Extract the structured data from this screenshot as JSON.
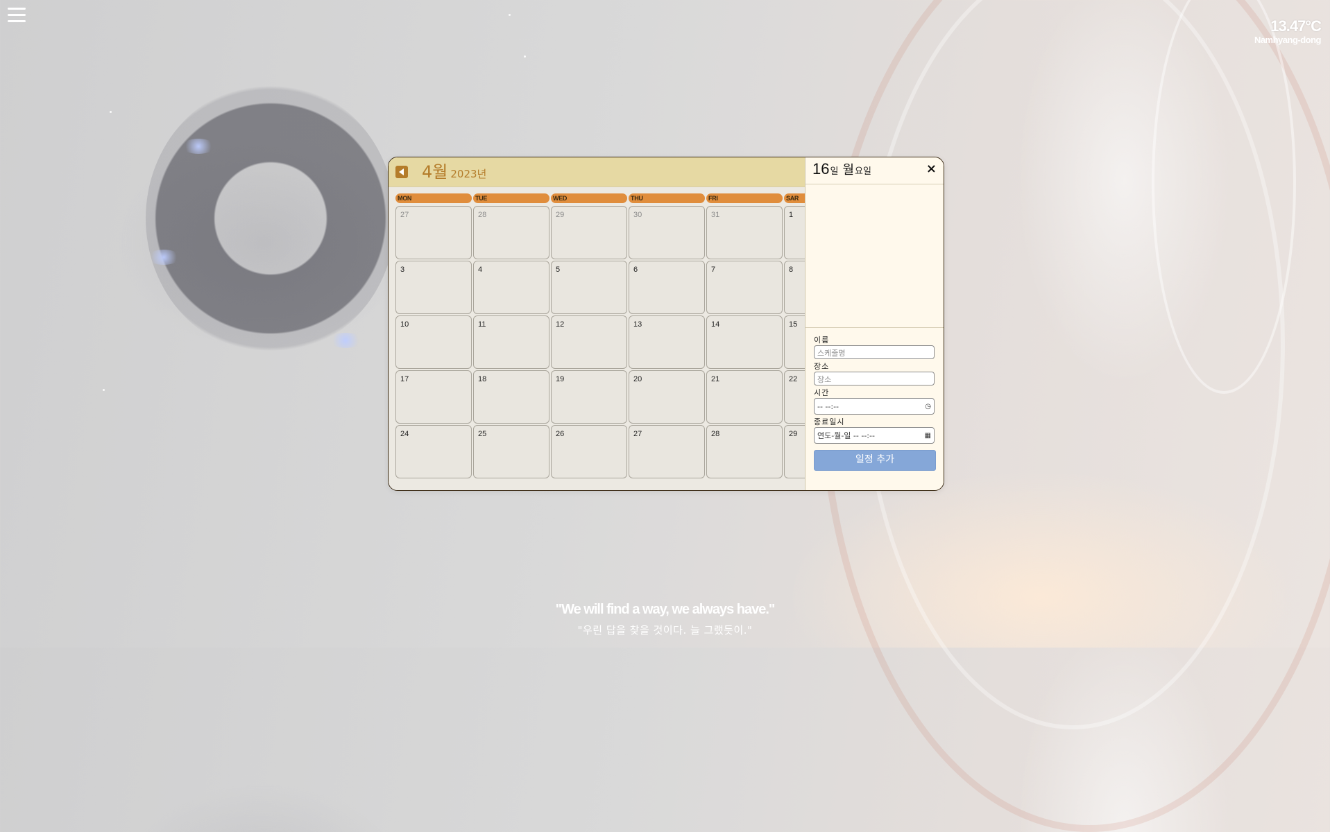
{
  "app": {
    "accent_color": "#b47c2a",
    "day_header_color": "#e08d3c",
    "button_color": "#85a7d8"
  },
  "menu": {
    "icon": "hamburger-menu-icon"
  },
  "weather": {
    "temperature": "13.47°C",
    "location": "Namhyang-dong"
  },
  "calendar": {
    "prev_icon": "chevron-left-icon",
    "month_label": "4월",
    "year_label": "2023년",
    "weekdays": [
      "MON",
      "TUE",
      "WED",
      "THU",
      "FRI",
      "SAR"
    ],
    "weeks": [
      [
        "27",
        "28",
        "29",
        "30",
        "31",
        "1"
      ],
      [
        "3",
        "4",
        "5",
        "6",
        "7",
        "8"
      ],
      [
        "10",
        "11",
        "12",
        "13",
        "14",
        "15"
      ],
      [
        "17",
        "18",
        "19",
        "20",
        "21",
        "22"
      ],
      [
        "24",
        "25",
        "26",
        "27",
        "28",
        "29"
      ]
    ]
  },
  "panel": {
    "day_number": "16",
    "day_unit": "일",
    "weekday": "월",
    "weekday_unit": "요일",
    "close_label": "×",
    "form": {
      "name_label": "이름",
      "name_placeholder": "스케줄명",
      "place_label": "장소",
      "place_placeholder": "장소",
      "time_label": "시간",
      "time_placeholder": "-- --:--",
      "end_label": "종료일시",
      "end_placeholder": "연도-월-일  -- --:--",
      "submit_label": "일정 추가"
    }
  },
  "quote": {
    "english": "\"We will find a way, we always have.\"",
    "korean": "\"우린 답을 찾을 것이다. 늘 그랬듯이.\""
  }
}
